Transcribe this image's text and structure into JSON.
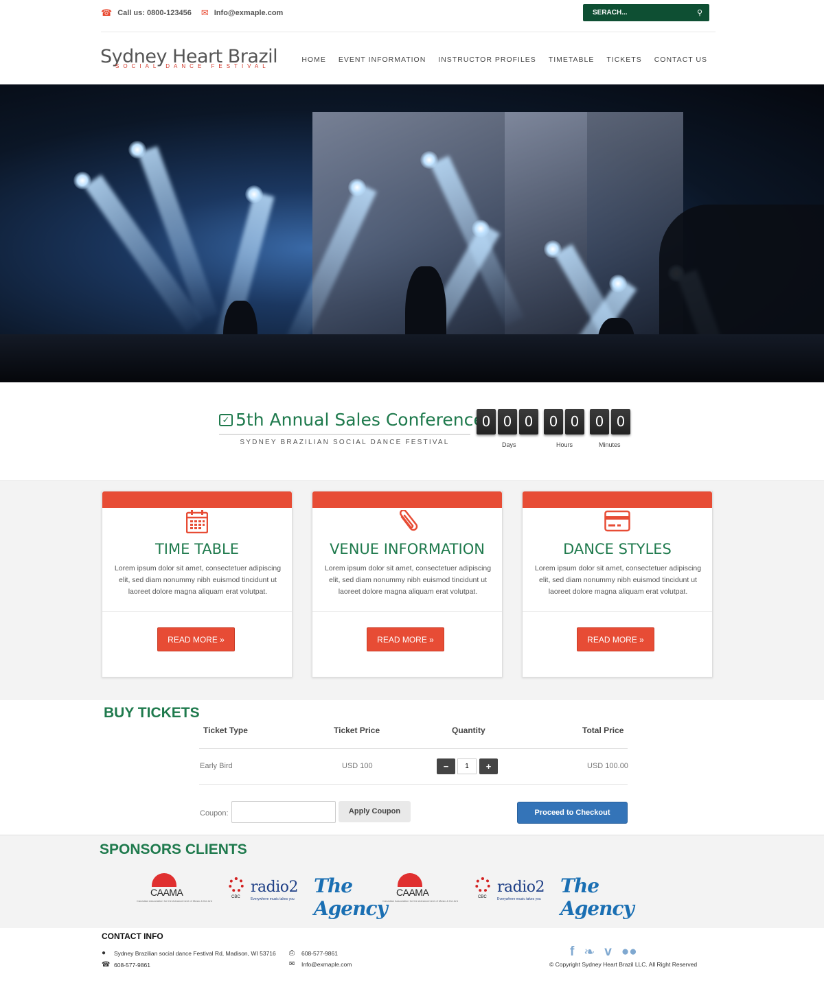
{
  "topbar": {
    "phone": "Call us: 0800-123456",
    "email": "Info@exmaple.com",
    "search_placeholder": "SERACH..."
  },
  "header": {
    "logo_main": "Sydney Heart Brazil",
    "logo_sub": "SOCIAL DANCE FESTIVAL",
    "nav": [
      "HOME",
      "EVENT INFORMATION",
      "INSTRUCTOR PROFILES",
      "TIMETABLE",
      "TICKETS",
      "CONTACT US"
    ]
  },
  "countdown": {
    "title": "5th Annual Sales Conference",
    "subtitle": "SYDNEY BRAZILIAN SOCIAL DANCE FESTIVAL",
    "digits": [
      "0",
      "0",
      "0",
      "0",
      "0",
      "0",
      "0"
    ],
    "labels": [
      "Days",
      "Hours",
      "Minutes"
    ]
  },
  "features": [
    {
      "title": "TIME TABLE",
      "icon": "calendar-icon",
      "text": "Lorem ipsum dolor sit amet, consectetuer adipiscing elit, sed diam nonummy nibh euismod tincidunt ut laoreet dolore magna aliquam erat volutpat.",
      "button": "READ MORE »"
    },
    {
      "title": "VENUE INFORMATION",
      "icon": "paperclip-icon",
      "text": "Lorem ipsum dolor sit amet, consectetuer adipiscing elit, sed diam nonummy nibh euismod tincidunt ut laoreet dolore magna aliquam erat volutpat.",
      "button": "READ MORE »"
    },
    {
      "title": "DANCE STYLES",
      "icon": "credit-card-icon",
      "text": "Lorem ipsum dolor sit amet, consectetuer adipiscing elit, sed diam nonummy nibh euismod tincidunt ut laoreet dolore magna aliquam erat volutpat.",
      "button": "READ MORE »"
    }
  ],
  "tickets": {
    "title": "BUY TICKETS",
    "headers": [
      "Ticket Type",
      "Ticket Price",
      "Quantity",
      "Total Price"
    ],
    "row": {
      "type": "Early Bird",
      "price": "USD 100",
      "quantity": "1",
      "total": "USD 100.00",
      "minus": "−",
      "plus": "+"
    },
    "coupon_label": "Coupon:",
    "apply_label": "Apply Coupon",
    "checkout_label": "Proceed to Checkout"
  },
  "sponsors": {
    "title": "SPONSORS CLIENTS",
    "caama": "CAAMA",
    "caama_tagline": "Canadian Association for the Advancement of Music & the Arts",
    "cbc": "CBC",
    "radio": "radio2",
    "radio_tagline": "Everywhere music takes you",
    "agency": "The Agency"
  },
  "footer": {
    "title": "CONTACT INFO",
    "address": "Sydney Brazilian social dance Festival Rd, Madison, WI 53716",
    "phone": "608-577-9861",
    "fax": "608-577-9861",
    "email": "Info@exmaple.com",
    "copyright": "© Copyright  Sydney Heart Brazil LLC. All Right Reserved"
  },
  "colors": {
    "accent": "#e74c35",
    "brand_green": "#1f7a4d",
    "search_bg": "#0e4f33",
    "checkout": "#3474b8"
  }
}
